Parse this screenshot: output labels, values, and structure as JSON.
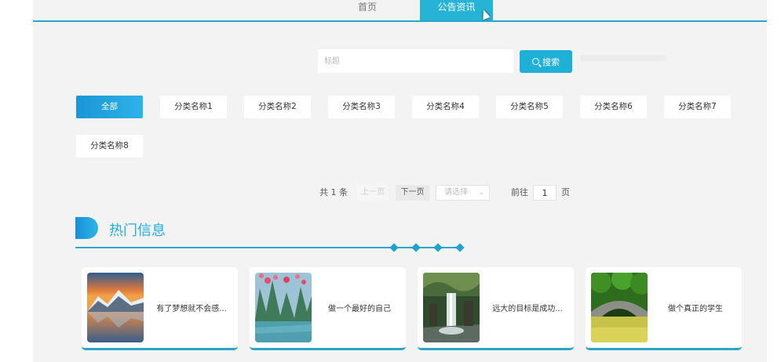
{
  "nav": {
    "items": [
      {
        "label": "首页"
      },
      {
        "label": "公告资讯"
      }
    ]
  },
  "search": {
    "placeholder": "标题",
    "button_label": "搜索"
  },
  "categories": [
    "全部",
    "分类名称1",
    "分类名称2",
    "分类名称3",
    "分类名称4",
    "分类名称5",
    "分类名称6",
    "分类名称7",
    "分类名称8"
  ],
  "pagination": {
    "total_prefix": "共",
    "total": "1",
    "total_suffix": "条",
    "prev_label": "上一页",
    "next_label": "下一页",
    "page_size_placeholder": "请选择",
    "goto_label": "前往",
    "current_page": "1",
    "page_unit": "页"
  },
  "hot": {
    "title": "热门信息",
    "cards": [
      {
        "title": "有了梦想就不会感..."
      },
      {
        "title": "做一个最好的自己"
      },
      {
        "title": "远大的目标是成功..."
      },
      {
        "title": "做个真正的学生"
      }
    ]
  },
  "colors": {
    "accent": "#27b3d6",
    "button": "#1fb0d8",
    "active_category_start": "#1a96d6",
    "active_category_end": "#2fb2e8",
    "background": "#f3f3f3"
  }
}
